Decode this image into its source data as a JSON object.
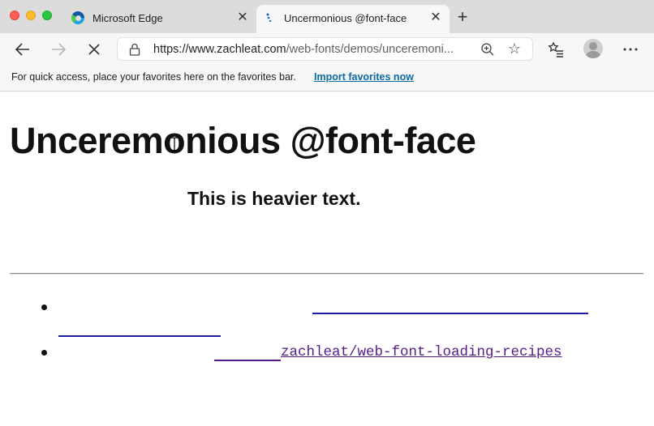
{
  "browser": {
    "tabs": [
      {
        "title": "Microsoft Edge",
        "favicon": "edge-logo-icon",
        "active": false
      },
      {
        "title": "Uncermonious @font-face",
        "favicon": "loading-spinner-icon",
        "active": true
      }
    ],
    "url_host": "https://www.zachleat.com",
    "url_rest": "/web-fonts/demos/unceremoni...",
    "favorites_bar": {
      "message": "For quick access, place your favorites here on the favorites bar.",
      "import_link": "Import favorites now"
    }
  },
  "page": {
    "heading": "Unceremonious @font-face",
    "subheading": "This is heavier text.",
    "links": [
      {
        "text": ""
      },
      {
        "text": "zachleat/web-font-loading-recipes"
      }
    ]
  },
  "colors": {
    "tabstrip": "#dcdcdc",
    "toolbar": "#f7f7f7",
    "link_blue": "#1a1aa6",
    "link_visited": "#551a8b",
    "favorites_link": "#0b6aa2"
  }
}
